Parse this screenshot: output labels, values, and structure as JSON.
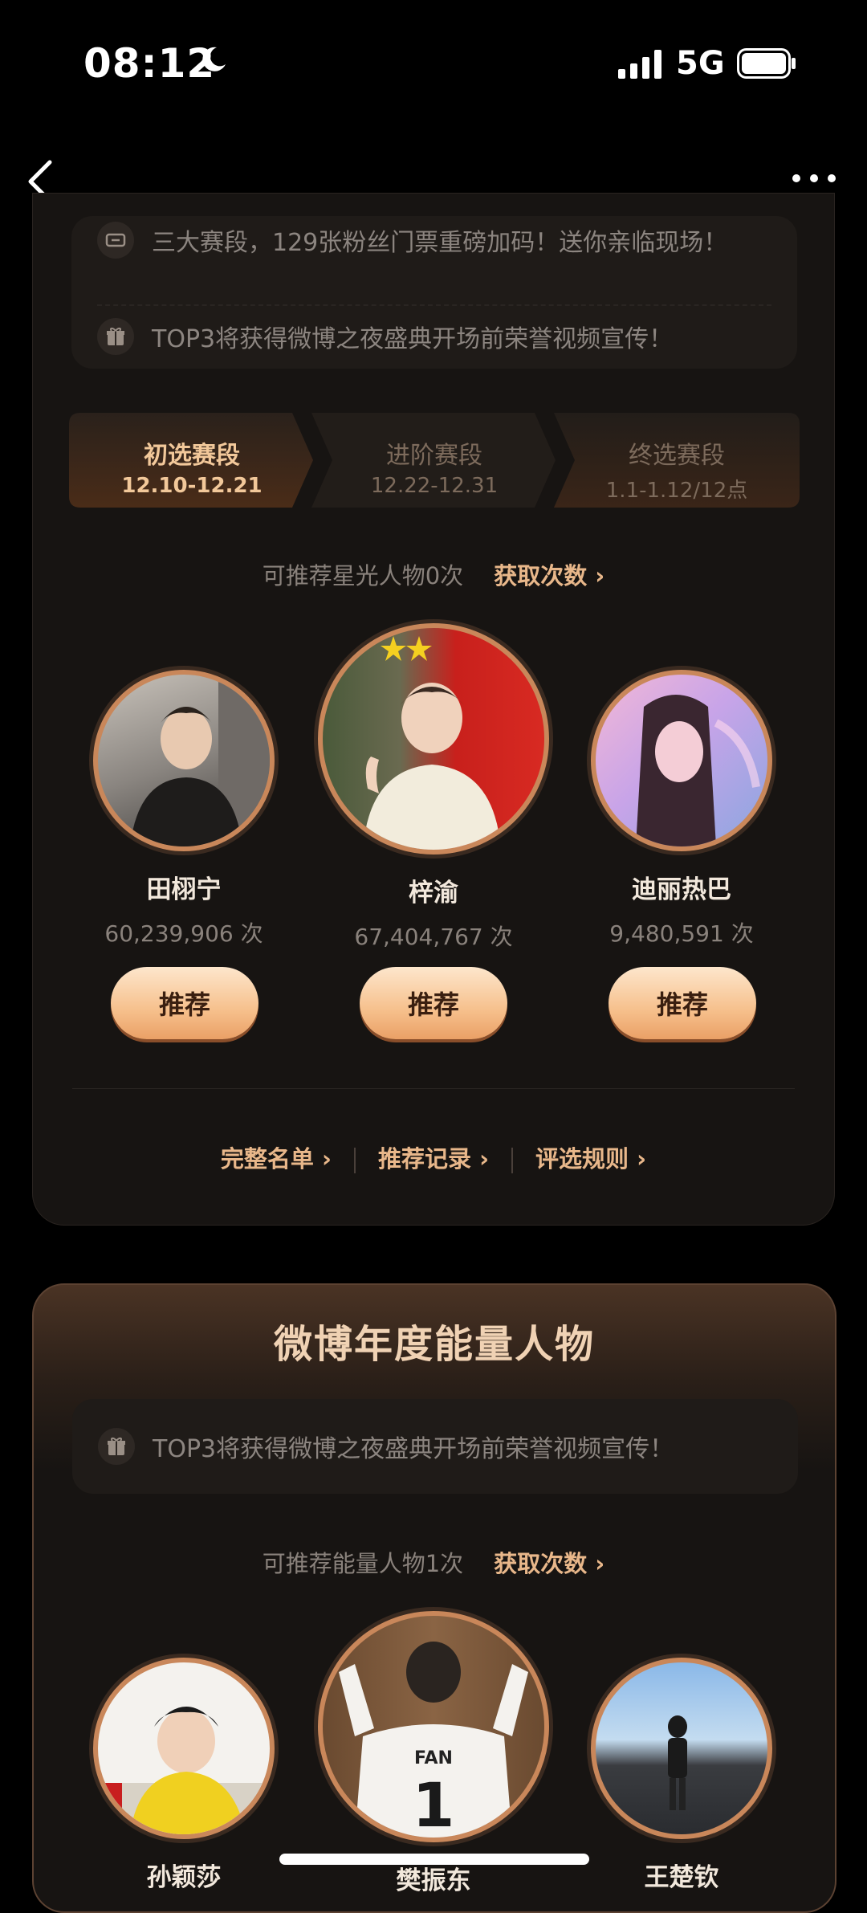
{
  "status": {
    "time": "08:12",
    "network": "5G"
  },
  "card1": {
    "info_lines": [
      {
        "icon": "ticket-icon",
        "text": "三大赛段，129张粉丝门票重磅加码！送你亲临现场！"
      },
      {
        "icon": "gift-icon",
        "text": "TOP3将获得微博之夜盛典开场前荣誉视频宣传！"
      }
    ],
    "tabs": [
      {
        "name": "初选赛段",
        "date": "12.10-12.21",
        "active": true
      },
      {
        "name": "进阶赛段",
        "date": "12.22-12.31",
        "active": false
      },
      {
        "name": "终选赛段",
        "date": "1.1-1.12/12点",
        "active": false
      }
    ],
    "quota_text": "可推荐星光人物0次",
    "quota_link": "获取次数",
    "people": [
      {
        "name": "田栩宁",
        "count": "60,239,906 次",
        "button": "推荐"
      },
      {
        "name": "梓渝",
        "count": "67,404,767 次",
        "button": "推荐"
      },
      {
        "name": "迪丽热巴",
        "count": "9,480,591 次",
        "button": "推荐"
      }
    ],
    "links": [
      "完整名单",
      "推荐记录",
      "评选规则"
    ]
  },
  "card2": {
    "title": "微博年度能量人物",
    "info_text": "TOP3将获得微博之夜盛典开场前荣誉视频宣传！",
    "quota_text": "可推荐能量人物1次",
    "quota_link": "获取次数",
    "people": [
      {
        "name": "孙颖莎"
      },
      {
        "name": "樊振东",
        "shirt_text": "FAN",
        "shirt_number": "1"
      },
      {
        "name": "王楚钦"
      }
    ]
  },
  "colors": {
    "accent": "#e8b78a",
    "button": "#f6c08c",
    "background": "#000000",
    "card": "#171412"
  }
}
